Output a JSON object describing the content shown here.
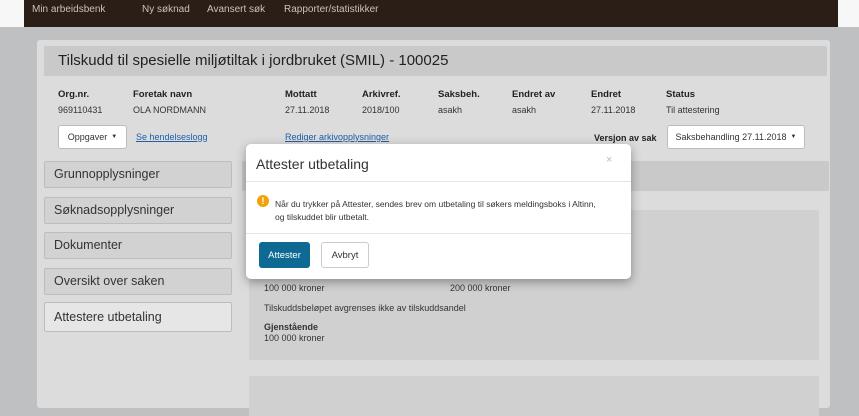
{
  "nav": {
    "items": [
      "Min arbeidsbenk",
      "Ny søknad",
      "Avansert søk",
      "Rapporter/statistikker"
    ]
  },
  "case": {
    "title": "Tilskudd til spesielle miljøtiltak i jordbruket (SMIL) - 100025",
    "fields": [
      {
        "label": "Org.nr.",
        "value": "969110431"
      },
      {
        "label": "Foretak navn",
        "value": "OLA NORDMANN"
      },
      {
        "label": "Mottatt",
        "value": "27.11.2018"
      },
      {
        "label": "Arkivref.",
        "value": "2018/100"
      },
      {
        "label": "Saksbeh.",
        "value": "asakh"
      },
      {
        "label": "Endret av",
        "value": "asakh"
      },
      {
        "label": "Endret",
        "value": "27.11.2018"
      },
      {
        "label": "Status",
        "value": "Til attestering"
      }
    ],
    "tasks_button": "Oppgaver",
    "history_link": "Se hendelseslogg",
    "archive_link": "Rediger arkivopplysninger",
    "version_label": "Versjon av sak",
    "version_value": "Saksbehandling 27.11.2018"
  },
  "sidebar": {
    "items": [
      "Grunnopplysninger",
      "Søknadsopplysninger",
      "Dokumenter",
      "Oversikt over saken",
      "Attestere utbetaling"
    ]
  },
  "content": {
    "amount1": "100 000 kroner",
    "amount2": "200 000 kroner",
    "note": "Tilskuddsbeløpet avgrenses ikke av tilskuddsandel",
    "remaining_label": "Gjenstående",
    "remaining_value": "100 000 kroner"
  },
  "modal": {
    "title": "Attester utbetaling",
    "close": "×",
    "message_line1": "Når du trykker på Attester, sendes brev om utbetaling til søkers meldingsboks i Altinn,",
    "message_line2": "og tilskuddet blir utbetalt.",
    "confirm": "Attester",
    "cancel": "Avbryt"
  },
  "colors": {
    "nav_bg": "#2a1e17",
    "primary_button": "#0e6a93",
    "warning": "#f0a30a",
    "link": "#1f5fa8"
  }
}
